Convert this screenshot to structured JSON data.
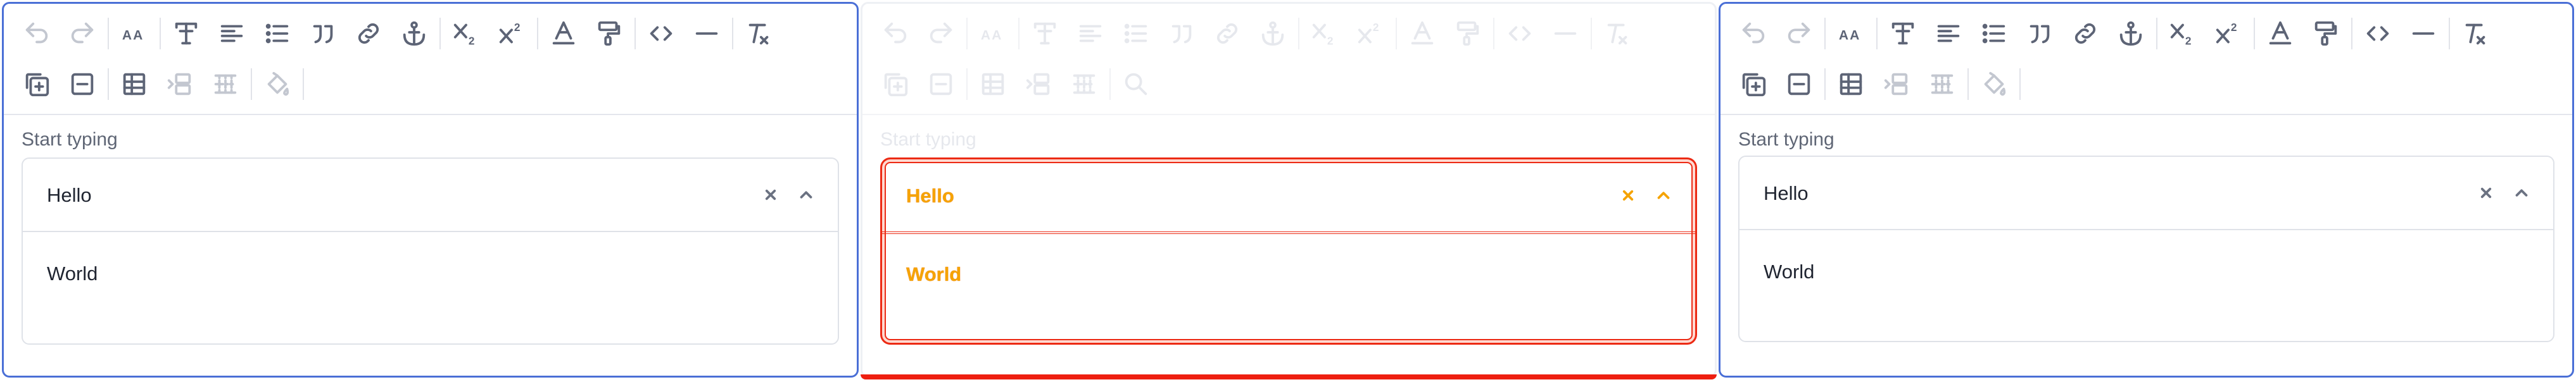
{
  "panels": [
    {
      "id": "editor-left",
      "toolbar": {
        "row1": [
          "undo-icon",
          "redo-icon",
          "font-size-icon",
          "text-style-icon",
          "align-left-icon",
          "bullet-list-icon",
          "blockquote-icon",
          "link-icon",
          "anchor-icon",
          "subscript-icon",
          "superscript-icon",
          "font-color-icon",
          "format-painter-icon",
          "code-icon",
          "horizontal-rule-icon",
          "clear-format-icon"
        ],
        "row2": [
          "add-cell-icon",
          "remove-cell-icon",
          "table-icon",
          "insert-row-icon",
          "delete-row-icon",
          "fill-color-icon"
        ]
      },
      "field_label": "Start typing",
      "combo": {
        "value": "Hello",
        "clear_icon": "close-icon",
        "toggle_icon": "chevron-up-icon"
      },
      "options": [
        "World"
      ]
    },
    {
      "id": "diff-overlay",
      "field_label": "Start typing",
      "combo": {
        "value": "Hello",
        "clear_icon": "close-icon",
        "toggle_icon": "chevron-up-icon"
      },
      "options": [
        "World"
      ]
    },
    {
      "id": "editor-right",
      "field_label": "Start typing",
      "combo": {
        "value": "Hello",
        "clear_icon": "close-icon",
        "toggle_icon": "chevron-up-icon"
      },
      "options": [
        "World"
      ]
    }
  ],
  "colors": {
    "panel_border": "#4a6fd6",
    "icon": "#5d6476",
    "icon_disabled": "#c3c7d0",
    "diff_red": "#ec2a14",
    "diff_orange": "#f5a300"
  }
}
